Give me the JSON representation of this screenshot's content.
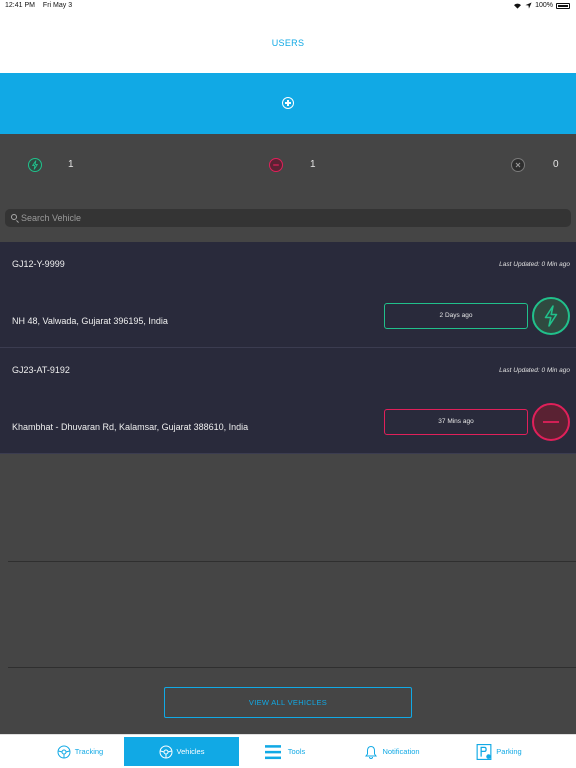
{
  "status_bar": {
    "time": "12:41 PM",
    "date": "Fri May 3",
    "battery": "100%"
  },
  "header": {
    "title": "USERS"
  },
  "summary": [
    {
      "icon": "lightning-icon",
      "count": "1",
      "color": "#21c08b"
    },
    {
      "icon": "minus-icon",
      "count": "1",
      "color": "#e0205a"
    },
    {
      "icon": "close-icon",
      "count": "0",
      "color": "#7a7a7a"
    }
  ],
  "search": {
    "placeholder": "Search Vehicle",
    "value": ""
  },
  "vehicles": [
    {
      "plate": "GJ12-Y-9999",
      "last_updated": "Last Updated: 0 Min ago",
      "address": "NH 48, Valwada, Gujarat 396195, India",
      "time_ago": "2 Days ago",
      "status": "active",
      "status_color": "#21c08b"
    },
    {
      "plate": "GJ23-AT-9192",
      "last_updated": "Last Updated: 0 Min ago",
      "address": "Khambhat - Dhuvaran Rd, Kalamsar, Gujarat 388610, India",
      "time_ago": "37 Mins ago",
      "status": "stopped",
      "status_color": "#e0205a"
    }
  ],
  "view_all_label": "VIEW ALL VEHICLES",
  "tabs": [
    {
      "label": "Tracking",
      "icon": "steering-wheel-icon",
      "active": false
    },
    {
      "label": "Vehicles",
      "icon": "steering-wheel-icon",
      "active": true
    },
    {
      "label": "Tools",
      "icon": "menu-icon",
      "active": false
    },
    {
      "label": "Notification",
      "icon": "bell-icon",
      "active": false
    },
    {
      "label": "Parking",
      "icon": "parking-icon",
      "active": false
    }
  ],
  "colors": {
    "accent": "#11a9e5",
    "background": "#454545",
    "row_background": "#292a3b"
  }
}
